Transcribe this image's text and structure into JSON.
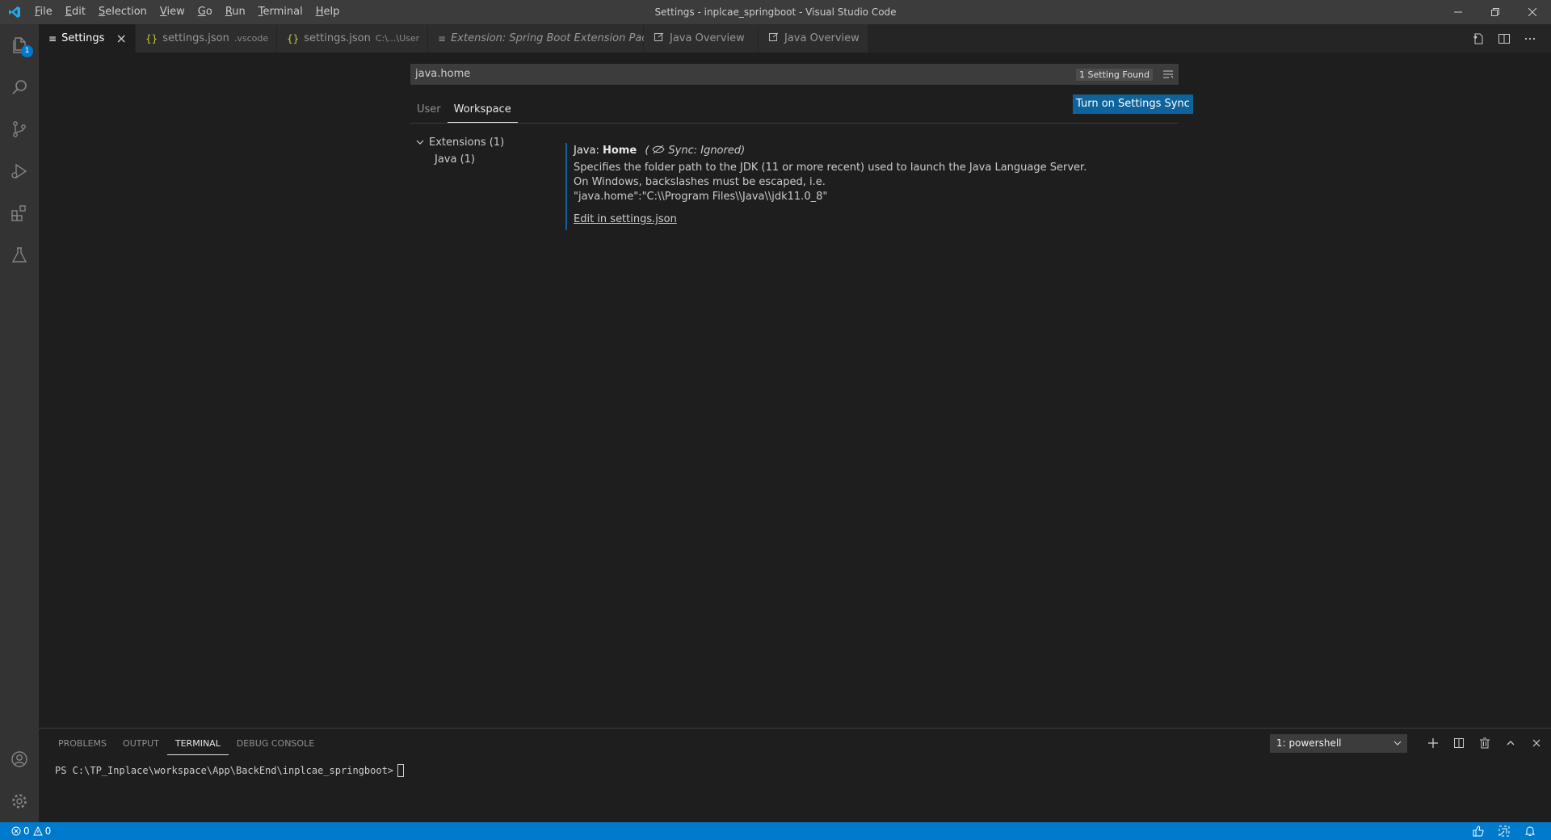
{
  "window": {
    "title": "Settings - inplcae_springboot - Visual Studio Code",
    "menu": [
      "File",
      "Edit",
      "Selection",
      "View",
      "Go",
      "Run",
      "Terminal",
      "Help"
    ]
  },
  "activitybar": {
    "explorer_badge": "1",
    "items": [
      "files-icon",
      "search-icon",
      "source-control-icon",
      "run-debug-icon",
      "extensions-icon",
      "testing-icon"
    ],
    "bottom": [
      "account-icon",
      "manage-gear-icon"
    ]
  },
  "tabs": [
    {
      "label": "Settings",
      "icon": "≡",
      "active": true
    },
    {
      "label": "settings.json",
      "icon": "{}",
      "desc": ".vscode"
    },
    {
      "label": "settings.json",
      "icon": "{}",
      "desc": "C:\\...\\User",
      "dirty": true
    },
    {
      "label": "Extension: Spring Boot Extension Pack",
      "icon": "≡",
      "italic": true
    },
    {
      "label": "Java Overview",
      "icon": "preview-icon"
    },
    {
      "label": "Java Overview",
      "icon": "preview-icon"
    }
  ],
  "settings": {
    "search_value": "java.home",
    "result_count": "1 Setting Found",
    "scopes": [
      "User",
      "Workspace"
    ],
    "active_scope": "Workspace",
    "sync_button": "Turn on Settings Sync",
    "toc": {
      "group": "Extensions (1)",
      "child": "Java (1)"
    },
    "item": {
      "category": "Java: ",
      "key": "Home",
      "sync_note": "Sync: Ignored)",
      "sync_open": "(",
      "desc_line1": "Specifies the folder path to the JDK (11 or more recent) used to launch the Java Language Server.",
      "desc_line2": "On Windows, backslashes must be escaped, i.e.",
      "desc_line3": "\"java.home\":\"C:\\\\Program Files\\\\Java\\\\jdk11.0_8\"",
      "edit_link": "Edit in settings.json"
    }
  },
  "panel": {
    "tabs": [
      "PROBLEMS",
      "OUTPUT",
      "TERMINAL",
      "DEBUG CONSOLE"
    ],
    "active_tab": "TERMINAL",
    "terminal_select": "1: powershell",
    "prompt": "PS C:\\TP_Inplace\\workspace\\App\\BackEnd\\inplcae_springboot>"
  },
  "statusbar": {
    "errors": "0",
    "warnings": "0"
  },
  "colors": {
    "accent": "#007acc",
    "button": "#0e639c",
    "titlebar": "#3c3c3c",
    "activitybar": "#333333",
    "editor": "#1e1e1e"
  }
}
